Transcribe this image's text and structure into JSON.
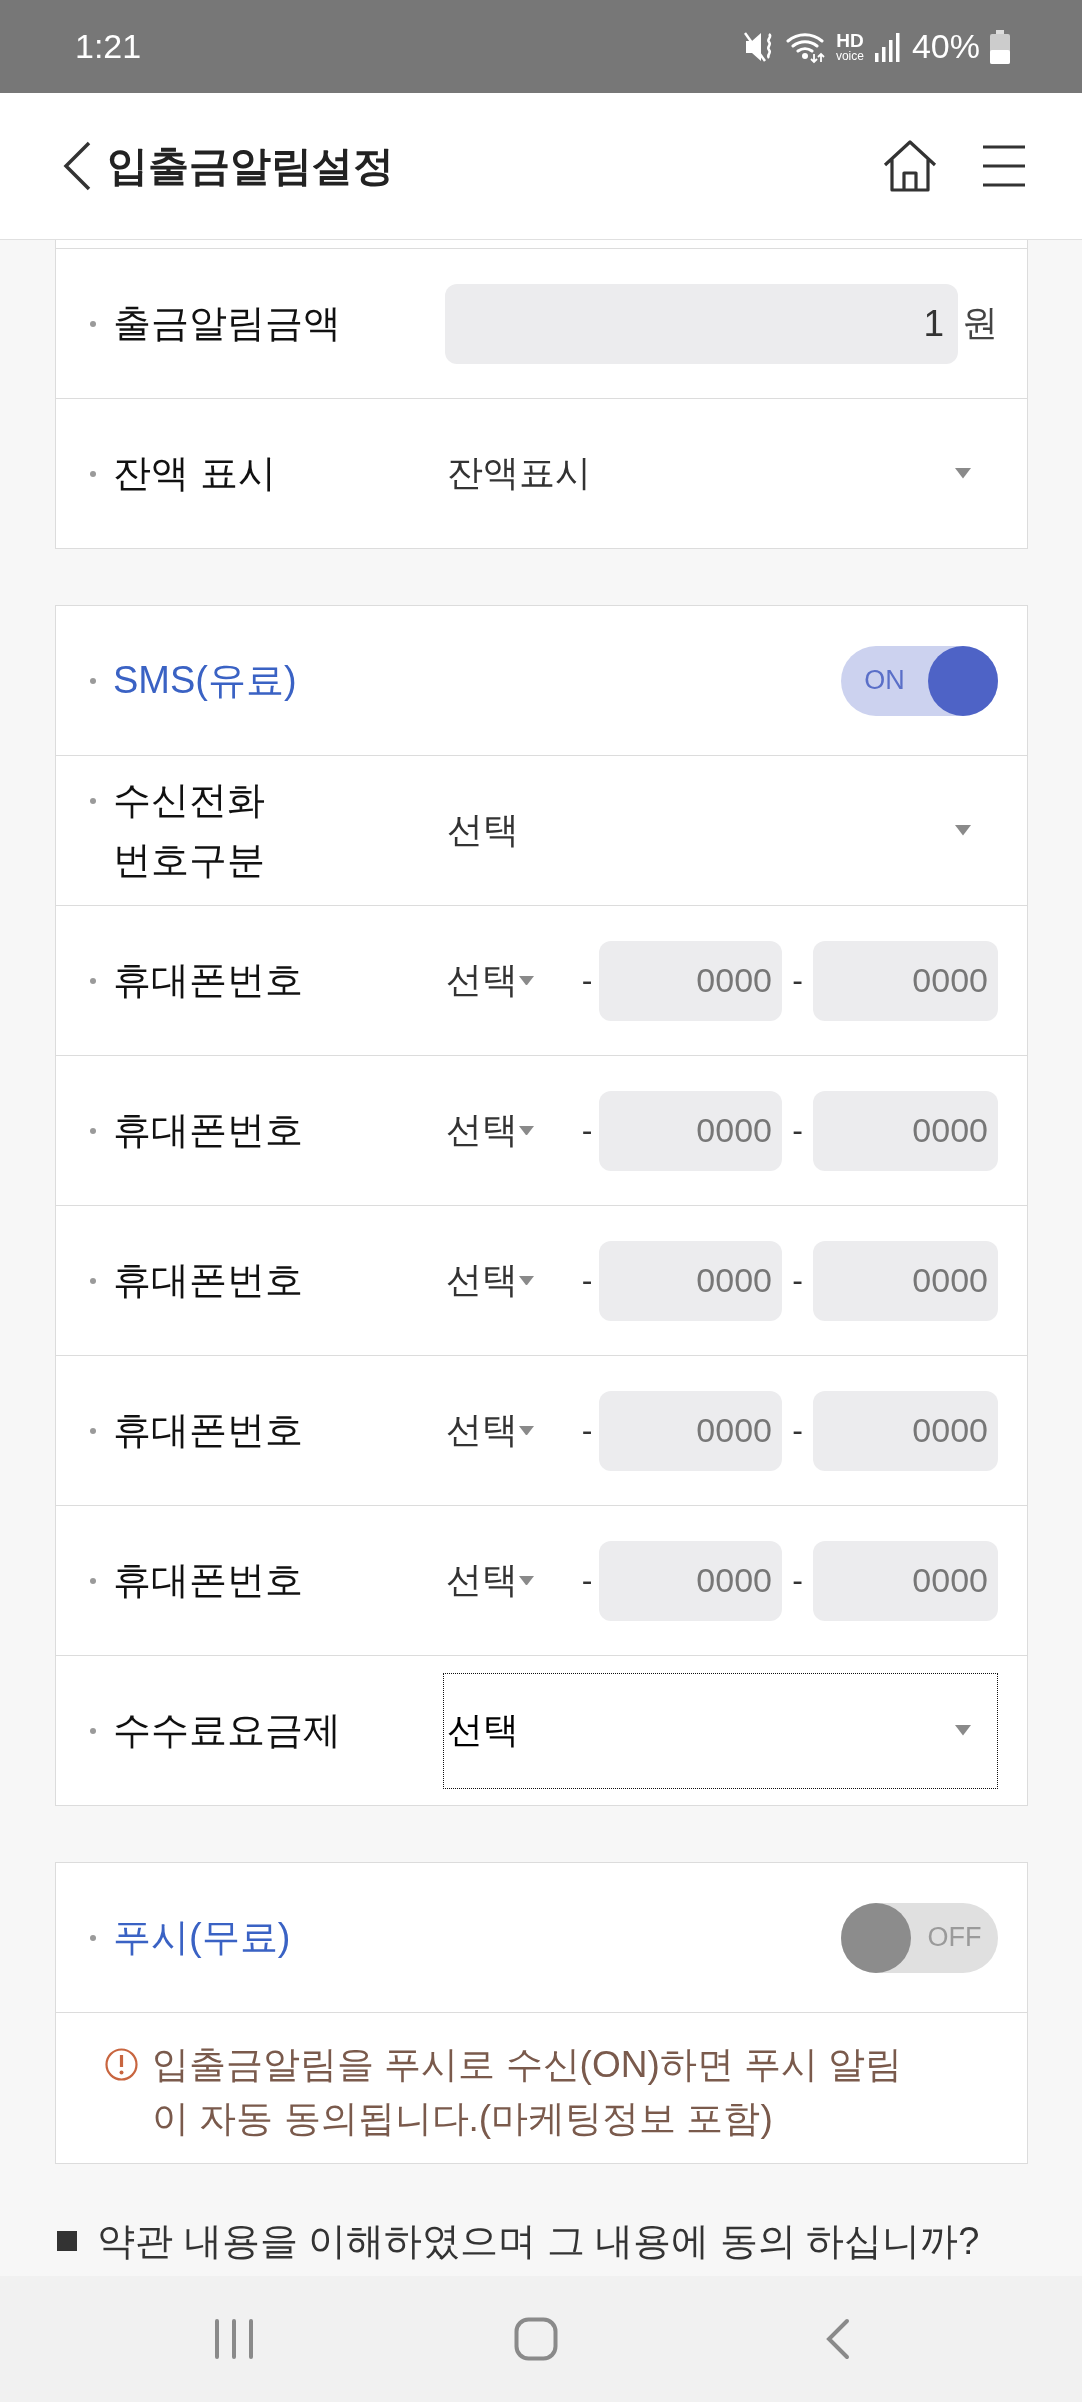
{
  "status_bar": {
    "time": "1:21",
    "hd_label": "HD",
    "hd_sublabel": "voice",
    "battery": "40%"
  },
  "header": {
    "title": "입출금알림설정"
  },
  "sections": [
    {
      "rows": [
        {
          "kind": "amount",
          "label": "출금알림금액",
          "value": "1",
          "unit": "원"
        },
        {
          "kind": "select",
          "label": "잔액 표시",
          "value": "잔액표시",
          "focused": false
        }
      ]
    },
    {
      "toggle": {
        "label": "SMS(유료)",
        "on": true,
        "text": "ON"
      },
      "rows": [
        {
          "kind": "select",
          "label": "수신전화\n번호구분",
          "value": "선택",
          "focused": false
        },
        {
          "kind": "phone",
          "label": "휴대폰번호",
          "prefix": "선택",
          "separators": [
            "-",
            "-"
          ],
          "placeholders": [
            "0000",
            "0000"
          ]
        },
        {
          "kind": "phone",
          "label": "휴대폰번호",
          "prefix": "선택",
          "separators": [
            "-",
            "-"
          ],
          "placeholders": [
            "0000",
            "0000"
          ]
        },
        {
          "kind": "phone",
          "label": "휴대폰번호",
          "prefix": "선택",
          "separators": [
            "-",
            "-"
          ],
          "placeholders": [
            "0000",
            "0000"
          ]
        },
        {
          "kind": "phone",
          "label": "휴대폰번호",
          "prefix": "선택",
          "separators": [
            "-",
            "-"
          ],
          "placeholders": [
            "0000",
            "0000"
          ]
        },
        {
          "kind": "phone",
          "label": "휴대폰번호",
          "prefix": "선택",
          "separators": [
            "-",
            "-"
          ],
          "placeholders": [
            "0000",
            "0000"
          ]
        },
        {
          "kind": "select",
          "label": "수수료요금제",
          "value": "선택",
          "focused": true
        }
      ]
    },
    {
      "toggle": {
        "label": "푸시(무료)",
        "on": false,
        "text": "OFF"
      },
      "notice": "입출금알림을 푸시로 수신(ON)하면 푸시 알림이 자동 동의됩니다.(마케팅정보 포함)"
    }
  ],
  "agreement": "약관 내용을 이해하였으며 그 내용에 동의 하십니까?"
}
